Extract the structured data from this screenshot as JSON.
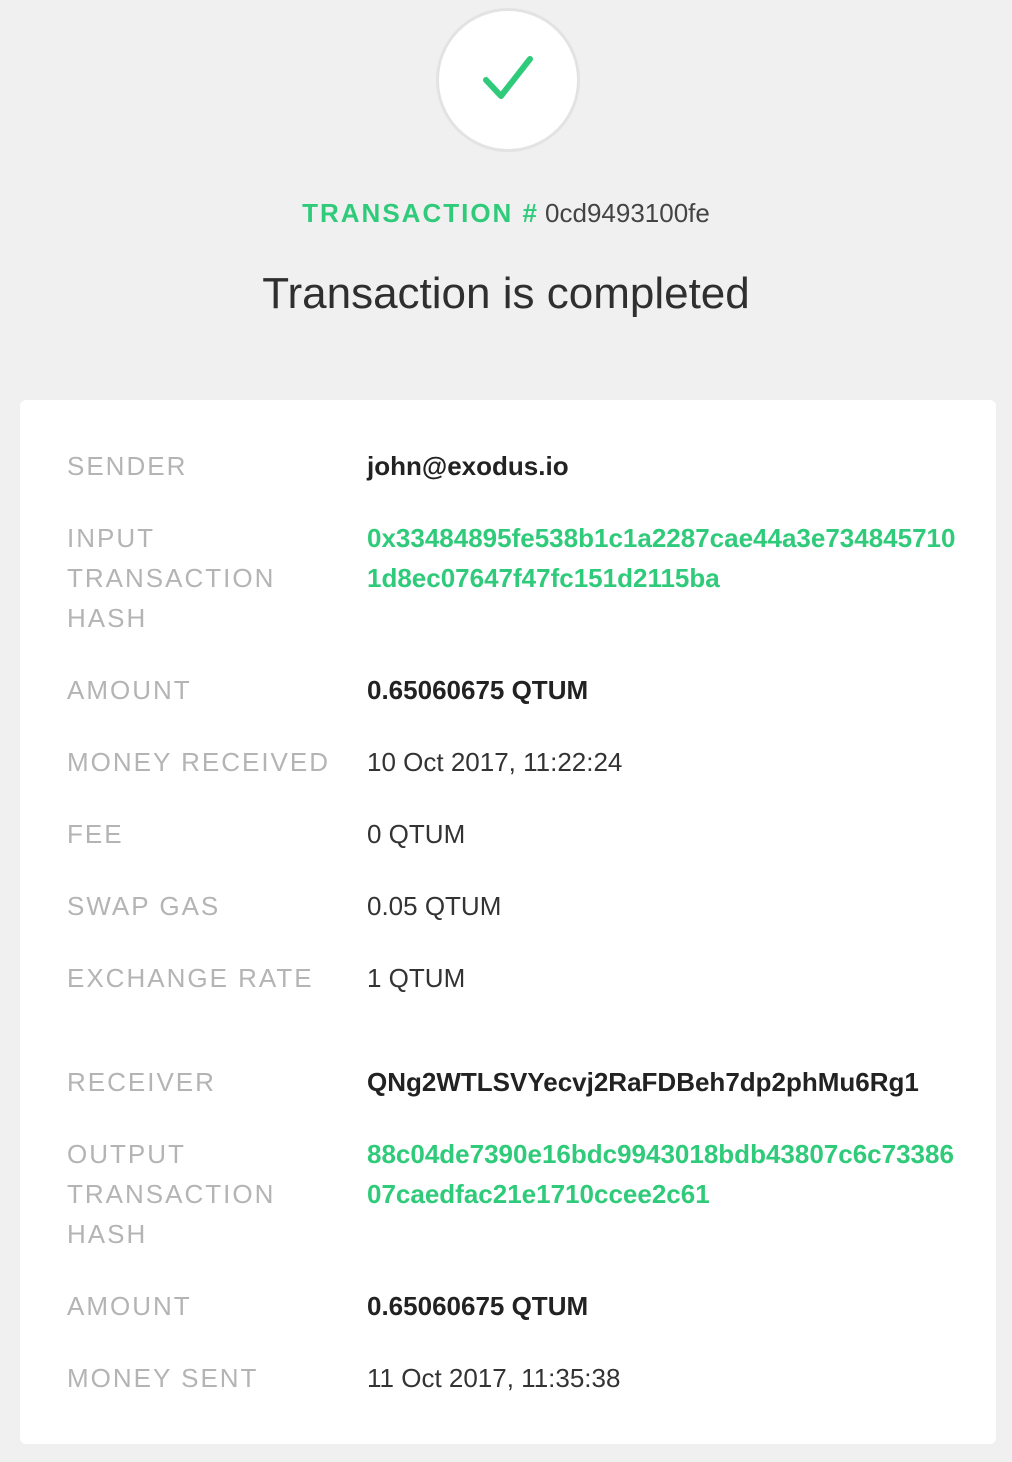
{
  "header": {
    "tx_label": "TRANSACTION #",
    "tx_hash": "0cd9493100fe",
    "title": "Transaction is completed"
  },
  "colors": {
    "accent": "#2fcb7a",
    "background": "#f0f0f0",
    "card": "#ffffff",
    "label": "#b4b4b4",
    "text": "#333333"
  },
  "details": {
    "sender_label": "SENDER",
    "sender_value": "john@exodus.io",
    "input_hash_label": "INPUT TRANSACTION HASH",
    "input_hash_value": "0x33484895fe538b1c1a2287cae44a3e7348457101d8ec07647f47fc151d2115ba",
    "amount_in_label": "AMOUNT",
    "amount_in_value": "0.65060675 QTUM",
    "money_received_label": "MONEY RECEIVED",
    "money_received_value": "10 Oct 2017, 11:22:24",
    "fee_label": "FEE",
    "fee_value": "0 QTUM",
    "swap_gas_label": "SWAP GAS",
    "swap_gas_value": "0.05 QTUM",
    "exchange_rate_label": "EXCHANGE RATE",
    "exchange_rate_value": "1 QTUM",
    "receiver_label": "RECEIVER",
    "receiver_value": "QNg2WTLSVYecvj2RaFDBeh7dp2phMu6Rg1",
    "output_hash_label": "OUTPUT TRANSACTION HASH",
    "output_hash_value": "88c04de7390e16bdc9943018bdb43807c6c7338607caedfac21e1710ccee2c61",
    "amount_out_label": "AMOUNT",
    "amount_out_value": "0.65060675 QTUM",
    "money_sent_label": "MONEY SENT",
    "money_sent_value": "11 Oct 2017, 11:35:38"
  }
}
